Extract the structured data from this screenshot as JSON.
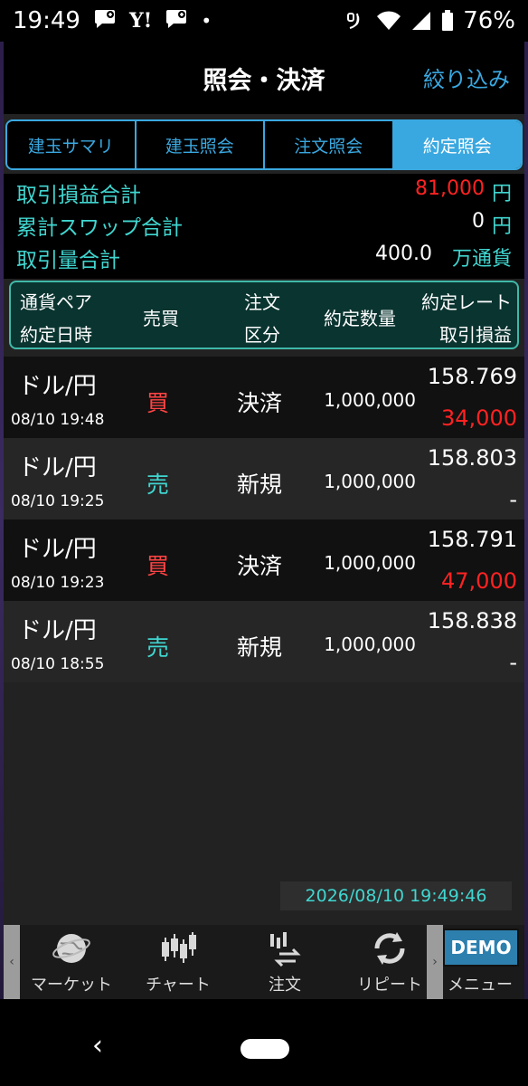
{
  "status_bar": {
    "time": "19:49",
    "icons": [
      "chat-icon",
      "yahoo-icon",
      "chat-icon",
      "dot"
    ],
    "yahoo_text": "Y!",
    "dot": "•",
    "battery": "76%"
  },
  "header": {
    "title": "照会・決済",
    "filter_label": "絞り込み"
  },
  "tabs": [
    {
      "label": "建玉サマリ",
      "active": false
    },
    {
      "label": "建玉照会",
      "active": false
    },
    {
      "label": "注文照会",
      "active": false
    },
    {
      "label": "約定照会",
      "active": true
    }
  ],
  "summary": {
    "profit_label": "取引損益合計",
    "profit_value": "81,000",
    "profit_unit": "円",
    "swap_label": "累計スワップ合計",
    "swap_value": "0",
    "swap_unit": "円",
    "volume_label": "取引量合計",
    "volume_value": "400.0",
    "volume_unit": "万通貨"
  },
  "columns": {
    "pair": "通貨ペア",
    "date": "約定日時",
    "side": "売買",
    "order1": "注文",
    "order2": "区分",
    "qty": "約定数量",
    "rate": "約定レート",
    "pl": "取引損益"
  },
  "trades": [
    {
      "pair": "ドル/円",
      "date": "08/10 19:48",
      "side": "買",
      "kind": "決済",
      "qty": "1,000,000",
      "rate": "158.769",
      "pl": "34,000"
    },
    {
      "pair": "ドル/円",
      "date": "08/10 19:25",
      "side": "売",
      "kind": "新規",
      "qty": "1,000,000",
      "rate": "158.803",
      "pl": "-"
    },
    {
      "pair": "ドル/円",
      "date": "08/10 19:23",
      "side": "買",
      "kind": "決済",
      "qty": "1,000,000",
      "rate": "158.791",
      "pl": "47,000"
    },
    {
      "pair": "ドル/円",
      "date": "08/10 18:55",
      "side": "売",
      "kind": "新規",
      "qty": "1,000,000",
      "rate": "158.838",
      "pl": "-"
    }
  ],
  "timestamp": "2026/08/10 19:49:46",
  "bottom_nav": {
    "left_arrow": "‹",
    "right_arrow": "›",
    "items": [
      {
        "label": "マーケット",
        "icon": "globe-icon"
      },
      {
        "label": "チャート",
        "icon": "candlestick-icon"
      },
      {
        "label": "注文",
        "icon": "order-icon"
      },
      {
        "label": "リピート",
        "icon": "repeat-icon"
      },
      {
        "label": "メニュー",
        "icon": "menu-icon"
      }
    ],
    "demo": "DEMO"
  },
  "system_nav": {
    "back": "‹"
  },
  "colors": {
    "accent": "#3aa8e0",
    "teal": "#40d6d0",
    "buy": "#ff4444",
    "profit": "#ff2222"
  }
}
